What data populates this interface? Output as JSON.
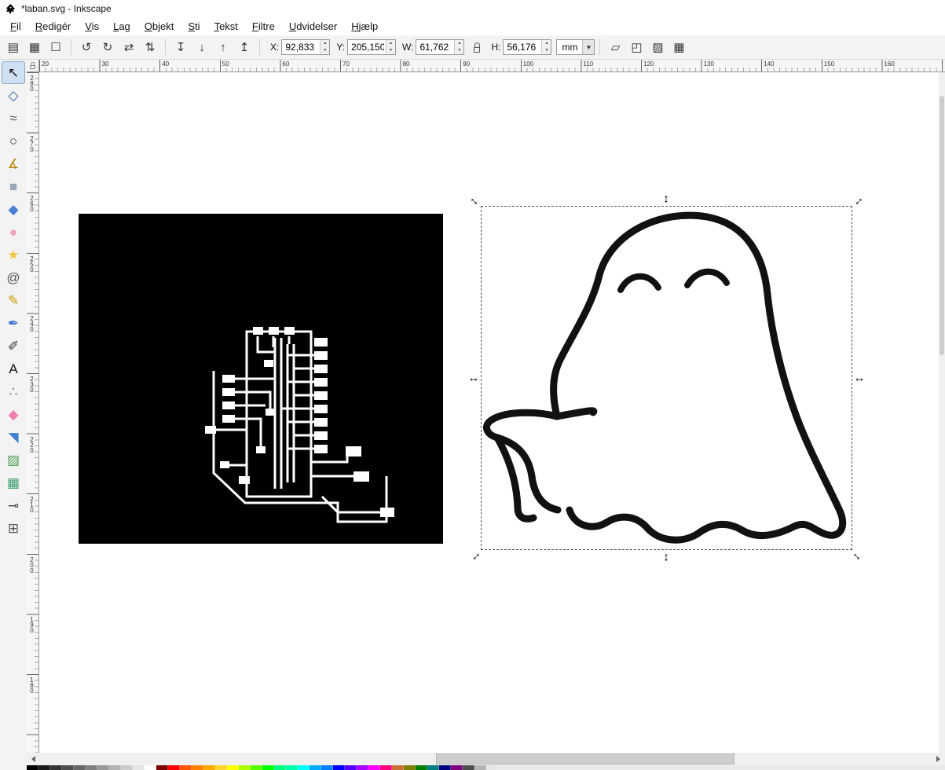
{
  "window": {
    "title": "*laban.svg - Inkscape"
  },
  "menus": [
    "Fil",
    "Redigér",
    "Vis",
    "Lag",
    "Objekt",
    "Sti",
    "Tekst",
    "Filtre",
    "Udvidelser",
    "Hjælp"
  ],
  "command_bar": {
    "groups": [
      [
        {
          "name": "select-all",
          "glyph": "▤"
        },
        {
          "name": "select-all-in-all-layers",
          "glyph": "▦"
        },
        {
          "name": "deselect",
          "glyph": "☐"
        }
      ],
      [
        {
          "name": "rotate-90-ccw",
          "glyph": "↺"
        },
        {
          "name": "rotate-90-cw",
          "glyph": "↻"
        },
        {
          "name": "flip-horizontal",
          "glyph": "⇄"
        },
        {
          "name": "flip-vertical",
          "glyph": "⇅"
        }
      ],
      [
        {
          "name": "lower-to-bottom",
          "glyph": "↧"
        },
        {
          "name": "lower",
          "glyph": "↓"
        },
        {
          "name": "raise",
          "glyph": "↑"
        },
        {
          "name": "raise-to-top",
          "glyph": "↥"
        }
      ]
    ],
    "fields": {
      "x": {
        "label": "X:",
        "value": "92,833"
      },
      "y": {
        "label": "Y:",
        "value": "205,150"
      },
      "w": {
        "label": "W:",
        "value": "61,762"
      },
      "h": {
        "label": "H:",
        "value": "56,176"
      }
    },
    "unit": "mm",
    "combo_arrow_glyph": "▼",
    "spinner_up_glyph": "▲",
    "spinner_down_glyph": "▼",
    "toggles": [
      {
        "name": "affect-stroke-width",
        "glyph": "▱"
      },
      {
        "name": "affect-rounded-corners",
        "glyph": "◰"
      },
      {
        "name": "affect-gradients",
        "glyph": "▨"
      },
      {
        "name": "affect-patterns",
        "glyph": "▦"
      }
    ]
  },
  "toolbox": [
    {
      "name": "selector-tool",
      "glyph": "↖",
      "color": "#111111",
      "active": true
    },
    {
      "name": "node-tool",
      "glyph": "◇",
      "color": "#2e5f9e",
      "active": false
    },
    {
      "name": "tweak-tool",
      "glyph": "≈",
      "color": "#555555",
      "active": false
    },
    {
      "name": "zoom-tool",
      "glyph": "○",
      "color": "#333333",
      "active": false
    },
    {
      "name": "measure-tool",
      "glyph": "∡",
      "color": "#b8860b",
      "active": false
    },
    {
      "name": "rectangle-tool",
      "glyph": "■",
      "color": "#9aa7b8",
      "active": false
    },
    {
      "name": "box-3d-tool",
      "glyph": "◆",
      "color": "#4a7fd4",
      "active": false
    },
    {
      "name": "ellipse-tool",
      "glyph": "●",
      "color": "#f0a0c0",
      "active": false
    },
    {
      "name": "star-tool",
      "glyph": "★",
      "color": "#f5c542",
      "active": false
    },
    {
      "name": "spiral-tool",
      "glyph": "@",
      "color": "#555555",
      "active": false
    },
    {
      "name": "pencil-tool",
      "glyph": "✎",
      "color": "#c99700",
      "active": false
    },
    {
      "name": "pen-tool",
      "glyph": "✒",
      "color": "#2f6fd0",
      "active": false
    },
    {
      "name": "calligraphy-tool",
      "glyph": "✐",
      "color": "#333333",
      "active": false
    },
    {
      "name": "text-tool",
      "glyph": "A",
      "color": "#111111",
      "active": false
    },
    {
      "name": "spray-tool",
      "glyph": "∴",
      "color": "#777777",
      "active": false
    },
    {
      "name": "eraser-tool",
      "glyph": "◆",
      "color": "#ef7fae",
      "active": false
    },
    {
      "name": "paint-bucket-tool",
      "glyph": "◥",
      "color": "#3f7fd4",
      "active": false
    },
    {
      "name": "gradient-tool",
      "glyph": "▨",
      "color": "#4f9e58",
      "active": false
    },
    {
      "name": "mesh-gradient-tool",
      "glyph": "▦",
      "color": "#3e9e6e",
      "active": false
    },
    {
      "name": "dropper-tool",
      "glyph": "⊸",
      "color": "#444444",
      "active": false
    },
    {
      "name": "connector-tool",
      "glyph": "⊞",
      "color": "#555555",
      "active": false
    }
  ],
  "rulers": {
    "horizontal_labels": [
      "20",
      "30",
      "40",
      "50",
      "60",
      "70",
      "80",
      "90",
      "100",
      "110",
      "120",
      "130",
      "140",
      "150",
      "160"
    ],
    "vertical_labels": [
      "280",
      "270",
      "260",
      "250",
      "240",
      "230",
      "220",
      "210",
      "200",
      "190",
      "180"
    ]
  },
  "selection": {
    "arrow_h": "↔",
    "arrow_v": "↕"
  },
  "palette": [
    "#000000",
    "#1a1a1a",
    "#333333",
    "#4d4d4d",
    "#666666",
    "#808080",
    "#999999",
    "#b3b3b3",
    "#cccccc",
    "#e6e6e6",
    "#ffffff",
    "#800000",
    "#ff0000",
    "#ff5500",
    "#ff8000",
    "#ffaa00",
    "#ffd42a",
    "#ffff00",
    "#aaff00",
    "#55ff00",
    "#00ff00",
    "#00ff80",
    "#00ffaa",
    "#00ffff",
    "#00aaff",
    "#0080ff",
    "#0000ff",
    "#5500ff",
    "#aa00ff",
    "#ff00ff",
    "#ff0080",
    "#c87137",
    "#808000",
    "#008000",
    "#008080",
    "#000080",
    "#800080",
    "#4d4d4d",
    "#b3b3b3",
    "#e6e6e6"
  ]
}
